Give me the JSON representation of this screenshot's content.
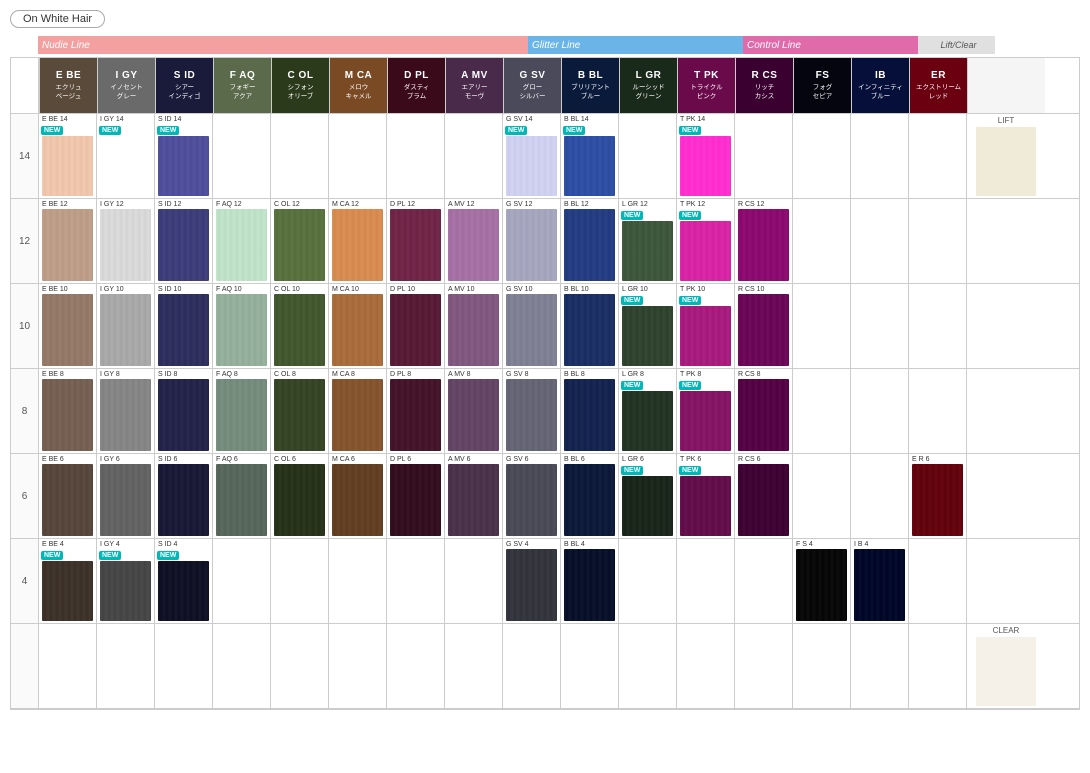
{
  "badge": "On White Hair",
  "lines": {
    "nudie": "Nudie Line",
    "glitter": "Glitter Line",
    "control": "Control Line",
    "liftclear": "Lift/Clear"
  },
  "colors": [
    {
      "code": "E BE",
      "jp1": "エクリュ",
      "jp2": "ベージュ",
      "key": "ebe"
    },
    {
      "code": "I GY",
      "jp1": "イノセント",
      "jp2": "グレー",
      "key": "igy"
    },
    {
      "code": "S ID",
      "jp1": "シアー",
      "jp2": "インディゴ",
      "key": "sid"
    },
    {
      "code": "F AQ",
      "jp1": "フォギー",
      "jp2": "アクア",
      "key": "faq"
    },
    {
      "code": "C OL",
      "jp1": "シフォン",
      "jp2": "オリーブ",
      "key": "col"
    },
    {
      "code": "M CA",
      "jp1": "メロウ",
      "jp2": "キャメル",
      "key": "mca"
    },
    {
      "code": "D PL",
      "jp1": "ダスティ",
      "jp2": "プラム",
      "key": "dpl"
    },
    {
      "code": "A MV",
      "jp1": "エアリー",
      "jp2": "モーヴ",
      "key": "amv"
    },
    {
      "code": "G SV",
      "jp1": "グロー",
      "jp2": "シルバー",
      "key": "gsv"
    },
    {
      "code": "B BL",
      "jp1": "ブリリアント",
      "jp2": "ブルー",
      "key": "bbl"
    },
    {
      "code": "L GR",
      "jp1": "ルーシッド",
      "jp2": "グリーン",
      "key": "lgr"
    },
    {
      "code": "T PK",
      "jp1": "トライクル",
      "jp2": "ピンク",
      "key": "tpk"
    },
    {
      "code": "R CS",
      "jp1": "リッチ",
      "jp2": "カシス",
      "key": "rcs"
    },
    {
      "code": "FS",
      "jp1": "フォグ",
      "jp2": "セピア",
      "key": "fs"
    },
    {
      "code": "IB",
      "jp1": "インフィニティ",
      "jp2": "ブルー",
      "key": "ib"
    },
    {
      "code": "ER",
      "jp1": "エクストリーム",
      "jp2": "レッド",
      "key": "er"
    }
  ],
  "levels": [
    {
      "num": "14",
      "cells": [
        {
          "key": "ebe",
          "label": "E BE 14",
          "new": true
        },
        {
          "key": "igy",
          "label": "I GY 14",
          "new": true
        },
        {
          "key": "sid",
          "label": "S ID 14",
          "new": true
        },
        {
          "key": "faq",
          "label": "",
          "new": false
        },
        {
          "key": "col",
          "label": "",
          "new": false
        },
        {
          "key": "mca",
          "label": "",
          "new": false
        },
        {
          "key": "dpl",
          "label": "",
          "new": false
        },
        {
          "key": "amv",
          "label": "",
          "new": false
        },
        {
          "key": "gsv",
          "label": "G SV 14",
          "new": true
        },
        {
          "key": "bbl",
          "label": "B BL 14",
          "new": true
        },
        {
          "key": "lgr",
          "label": "",
          "new": false
        },
        {
          "key": "tpk",
          "label": "T PK 14",
          "new": true
        },
        {
          "key": "rcs",
          "label": "",
          "new": false
        },
        {
          "key": "fs",
          "label": "",
          "new": false
        },
        {
          "key": "ib",
          "label": "",
          "new": false
        },
        {
          "key": "er",
          "label": "",
          "new": false
        }
      ],
      "liftclear": "LIFT"
    },
    {
      "num": "12",
      "cells": [
        {
          "key": "ebe",
          "label": "E BE 12",
          "new": false
        },
        {
          "key": "igy",
          "label": "I GY 12",
          "new": false
        },
        {
          "key": "sid",
          "label": "S ID 12",
          "new": false
        },
        {
          "key": "faq",
          "label": "F AQ 12",
          "new": false
        },
        {
          "key": "col",
          "label": "C OL 12",
          "new": false
        },
        {
          "key": "mca",
          "label": "M CA 12",
          "new": false
        },
        {
          "key": "dpl",
          "label": "D PL 12",
          "new": false
        },
        {
          "key": "amv",
          "label": "A MV 12",
          "new": false
        },
        {
          "key": "gsv",
          "label": "G SV 12",
          "new": false
        },
        {
          "key": "bbl",
          "label": "B BL 12",
          "new": false
        },
        {
          "key": "lgr",
          "label": "L GR 12",
          "new": true
        },
        {
          "key": "tpk",
          "label": "T PK 12",
          "new": true
        },
        {
          "key": "rcs",
          "label": "R CS 12",
          "new": false
        },
        {
          "key": "fs",
          "label": "",
          "new": false
        },
        {
          "key": "ib",
          "label": "",
          "new": false
        },
        {
          "key": "er",
          "label": "",
          "new": false
        }
      ],
      "liftclear": ""
    },
    {
      "num": "10",
      "cells": [
        {
          "key": "ebe",
          "label": "E BE 10",
          "new": false
        },
        {
          "key": "igy",
          "label": "I GY 10",
          "new": false
        },
        {
          "key": "sid",
          "label": "S ID 10",
          "new": false
        },
        {
          "key": "faq",
          "label": "F AQ 10",
          "new": false
        },
        {
          "key": "col",
          "label": "C OL 10",
          "new": false
        },
        {
          "key": "mca",
          "label": "M CA 10",
          "new": false
        },
        {
          "key": "dpl",
          "label": "D PL 10",
          "new": false
        },
        {
          "key": "amv",
          "label": "A MV 10",
          "new": false
        },
        {
          "key": "gsv",
          "label": "G SV 10",
          "new": false
        },
        {
          "key": "bbl",
          "label": "B BL 10",
          "new": false
        },
        {
          "key": "lgr",
          "label": "L GR 10",
          "new": true
        },
        {
          "key": "tpk",
          "label": "T PK 10",
          "new": true
        },
        {
          "key": "rcs",
          "label": "R CS 10",
          "new": false
        },
        {
          "key": "fs",
          "label": "",
          "new": false
        },
        {
          "key": "ib",
          "label": "",
          "new": false
        },
        {
          "key": "er",
          "label": "",
          "new": false
        }
      ],
      "liftclear": ""
    },
    {
      "num": "8",
      "cells": [
        {
          "key": "ebe",
          "label": "E BE 8",
          "new": false
        },
        {
          "key": "igy",
          "label": "I GY 8",
          "new": false
        },
        {
          "key": "sid",
          "label": "S ID 8",
          "new": false
        },
        {
          "key": "faq",
          "label": "F AQ 8",
          "new": false
        },
        {
          "key": "col",
          "label": "C OL 8",
          "new": false
        },
        {
          "key": "mca",
          "label": "M CA 8",
          "new": false
        },
        {
          "key": "dpl",
          "label": "D PL 8",
          "new": false
        },
        {
          "key": "amv",
          "label": "A MV 8",
          "new": false
        },
        {
          "key": "gsv",
          "label": "G SV 8",
          "new": false
        },
        {
          "key": "bbl",
          "label": "B BL 8",
          "new": false
        },
        {
          "key": "lgr",
          "label": "L GR 8",
          "new": true
        },
        {
          "key": "tpk",
          "label": "T PK 8",
          "new": true
        },
        {
          "key": "rcs",
          "label": "R CS 8",
          "new": false
        },
        {
          "key": "fs",
          "label": "",
          "new": false
        },
        {
          "key": "ib",
          "label": "",
          "new": false
        },
        {
          "key": "er",
          "label": "",
          "new": false
        }
      ],
      "liftclear": ""
    },
    {
      "num": "6",
      "cells": [
        {
          "key": "ebe",
          "label": "E BE 6",
          "new": false
        },
        {
          "key": "igy",
          "label": "I GY 6",
          "new": false
        },
        {
          "key": "sid",
          "label": "S ID 6",
          "new": false
        },
        {
          "key": "faq",
          "label": "F AQ 6",
          "new": false
        },
        {
          "key": "col",
          "label": "C OL 6",
          "new": false
        },
        {
          "key": "mca",
          "label": "M CA 6",
          "new": false
        },
        {
          "key": "dpl",
          "label": "D PL 6",
          "new": false
        },
        {
          "key": "amv",
          "label": "A MV 6",
          "new": false
        },
        {
          "key": "gsv",
          "label": "G SV 6",
          "new": false
        },
        {
          "key": "bbl",
          "label": "B BL 6",
          "new": false
        },
        {
          "key": "lgr",
          "label": "L GR 6",
          "new": true
        },
        {
          "key": "tpk",
          "label": "T PK 6",
          "new": true
        },
        {
          "key": "rcs",
          "label": "R CS 6",
          "new": false
        },
        {
          "key": "fs",
          "label": "",
          "new": false
        },
        {
          "key": "ib",
          "label": "",
          "new": false
        },
        {
          "key": "er",
          "label": "E R 6",
          "new": false
        }
      ],
      "liftclear": ""
    },
    {
      "num": "4",
      "cells": [
        {
          "key": "ebe",
          "label": "E BE 4",
          "new": true
        },
        {
          "key": "igy",
          "label": "I GY 4",
          "new": true
        },
        {
          "key": "sid",
          "label": "S ID 4",
          "new": true
        },
        {
          "key": "faq",
          "label": "",
          "new": false
        },
        {
          "key": "col",
          "label": "",
          "new": false
        },
        {
          "key": "mca",
          "label": "",
          "new": false
        },
        {
          "key": "dpl",
          "label": "",
          "new": false
        },
        {
          "key": "amv",
          "label": "",
          "new": false
        },
        {
          "key": "gsv",
          "label": "G SV 4",
          "new": false
        },
        {
          "key": "bbl",
          "label": "B BL 4",
          "new": false
        },
        {
          "key": "lgr",
          "label": "",
          "new": false
        },
        {
          "key": "tpk",
          "label": "",
          "new": false
        },
        {
          "key": "rcs",
          "label": "",
          "new": false
        },
        {
          "key": "fs",
          "label": "F S 4",
          "new": false
        },
        {
          "key": "ib",
          "label": "I B 4",
          "new": false
        },
        {
          "key": "er",
          "label": "",
          "new": false
        }
      ],
      "liftclear": ""
    },
    {
      "num": "",
      "cells": [
        {
          "key": "empty",
          "label": "",
          "new": false
        },
        {
          "key": "empty",
          "label": "",
          "new": false
        },
        {
          "key": "empty",
          "label": "",
          "new": false
        },
        {
          "key": "empty",
          "label": "",
          "new": false
        },
        {
          "key": "empty",
          "label": "",
          "new": false
        },
        {
          "key": "empty",
          "label": "",
          "new": false
        },
        {
          "key": "empty",
          "label": "",
          "new": false
        },
        {
          "key": "empty",
          "label": "",
          "new": false
        },
        {
          "key": "empty",
          "label": "",
          "new": false
        },
        {
          "key": "empty",
          "label": "",
          "new": false
        },
        {
          "key": "empty",
          "label": "",
          "new": false
        },
        {
          "key": "empty",
          "label": "",
          "new": false
        },
        {
          "key": "empty",
          "label": "",
          "new": false
        },
        {
          "key": "empty",
          "label": "",
          "new": false
        },
        {
          "key": "empty",
          "label": "",
          "new": false
        },
        {
          "key": "empty",
          "label": "",
          "new": false
        }
      ],
      "liftclear": "CLEAR"
    }
  ],
  "swatchColors": {
    "ebe": "#7a6558",
    "igy": "#8a8a8a",
    "sid": "#2a2a50",
    "faq": "#7a9080",
    "col": "#3a4a2a",
    "mca": "#8a5a35",
    "dpl": "#4a1a30",
    "amv": "#6a4a6a",
    "gsv": "#6a6a7a",
    "bbl": "#1a2a55",
    "lgr": "#2a3a2a",
    "tpk": "#8a1a6a",
    "rcs": "#5a0a4a",
    "fs": "#1a1a1a",
    "ib": "#0a1a55",
    "er": "#8a0a1a"
  },
  "levelBrightness": {
    "14": 2.0,
    "12": 1.6,
    "10": 1.25,
    "8": 1.0,
    "6": 0.75,
    "4": 0.55
  }
}
